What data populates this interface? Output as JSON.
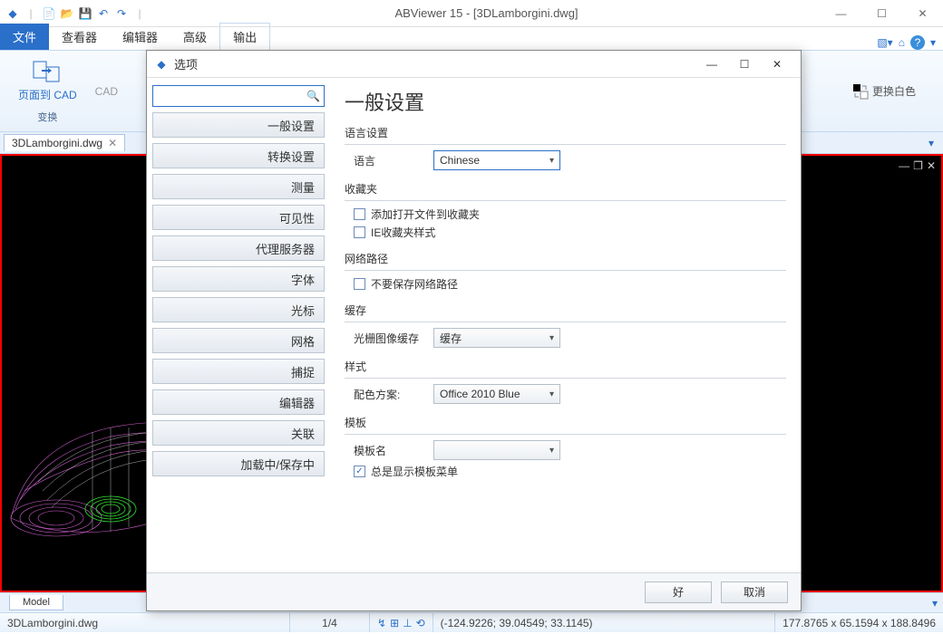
{
  "app": {
    "title": "ABViewer 15 - [3DLamborgini.dwg]"
  },
  "ribbon": {
    "tabs": [
      "文件",
      "查看器",
      "编辑器",
      "高级",
      "输出"
    ],
    "active": 0,
    "page_to_cad": "页面到 CAD",
    "cad_label": "CAD",
    "group_convert": "变换",
    "change_white": "更换白色"
  },
  "doctab": {
    "name": "3DLamborgini.dwg"
  },
  "bottom": {
    "model": "Model"
  },
  "status": {
    "file": "3DLamborgini.dwg",
    "page": "1/4",
    "coords": "(-124.9226; 39.04549; 33.1145)",
    "extent": "177.8765 x 65.1594 x 188.8496"
  },
  "dialog": {
    "title": "选项",
    "nav": [
      "一般设置",
      "转换设置",
      "测量",
      "可见性",
      "代理服务器",
      "字体",
      "光标",
      "网格",
      "捕捉",
      "编辑器",
      "关联",
      "加载中/保存中"
    ],
    "heading": "一般设置",
    "lang_section": "语言设置",
    "lang_label": "语言",
    "lang_value": "Chinese",
    "fav_section": "收藏夹",
    "fav_add": "添加打开文件到收藏夹",
    "fav_ie": "IE收藏夹样式",
    "net_section": "网络路径",
    "net_dont": "不要保存网络路径",
    "cache_section": "缓存",
    "cache_label": "光栅图像缓存",
    "cache_value": "缓存",
    "style_section": "样式",
    "style_label": "配色方案:",
    "style_value": "Office 2010 Blue",
    "tpl_section": "模板",
    "tpl_label": "模板名",
    "tpl_value": "",
    "tpl_always": "总是显示模板菜单",
    "ok": "好",
    "cancel": "取消"
  }
}
